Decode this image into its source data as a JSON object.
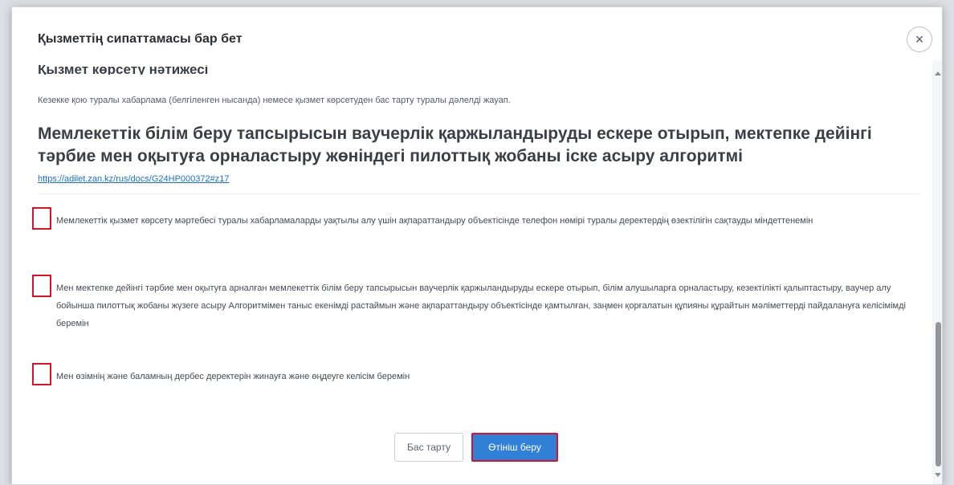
{
  "modal": {
    "title": "Қызметтің сипаттамасы бар бет",
    "close_label": "×"
  },
  "content": {
    "cut_heading": "Қызмет көрсету нәтижесі",
    "result_text": "Кезекке қою туралы хабарлама (белгіленген нысанда) немесе қызмет көрсетуден бас тарту туралы дәлелді жауап.",
    "algorithm_title": "Мемлекеттік білім беру тапсырысын ваучерлік қаржыландыруды ескере отырып, мектепке дейінгі тәрбие мен оқытуға орналастыру жөніндегі пилоттық жобаны іске асыру алгоритмі",
    "link": "https://adilet.zan.kz/rus/docs/G24HP000372#z17"
  },
  "checkboxes": [
    {
      "text": "Мемлекеттік қызмет көрсету мәртебесі туралы хабарламаларды уақтылы алу үшін ақпараттандыру объектісінде телефон нөмірі туралы деректердің өзектілігін сақтауды міндеттенемін",
      "checked": false
    },
    {
      "text": "Мен мектепке дейінгі тәрбие мен оқытуға арналған мемлекеттік білім беру тапсырысын ваучерлік қаржыландыруды ескере отырып, білім алушыларға орналастыру, кезектілікті қалыптастыру, ваучер алу бойынша пилоттық жобаны жүзеге асыру Алгоритмімен таныс екенімді растаймын және ақпараттандыру объектісінде қамтылған, заңмен қорғалатын құпияны құрайтын мәліметтерді пайдалануға келісімімді беремін",
      "checked": false
    },
    {
      "text": "Мен өзімнің және баламның дербес деректерін жинауға және өңдеуге келісім беремін",
      "checked": false
    }
  ],
  "buttons": {
    "cancel": "Бас тарту",
    "submit": "Өтініш беру"
  },
  "colors": {
    "accent": "#2f80d6",
    "highlight": "#d9122c",
    "link": "#1a6fc4"
  }
}
